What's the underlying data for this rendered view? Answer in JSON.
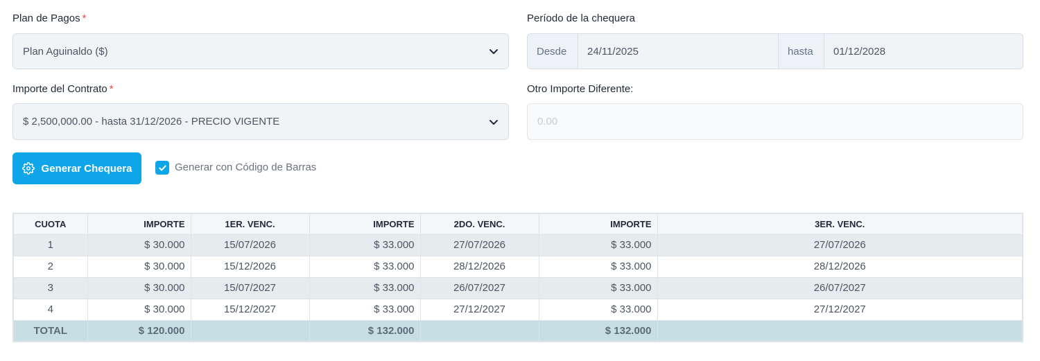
{
  "plan": {
    "label": "Plan de Pagos",
    "required_mark": "*",
    "value": "Plan Aguinaldo ($)"
  },
  "periodo": {
    "label": "Período de la chequera",
    "desde_label": "Desde",
    "desde_value": "24/11/2025",
    "hasta_label": "hasta",
    "hasta_value": "01/12/2028"
  },
  "importe_contrato": {
    "label": "Importe del Contrato",
    "required_mark": "*",
    "value": "$ 2,500,000.00 - hasta 31/12/2026 - PRECIO VIGENTE"
  },
  "otro_importe": {
    "label": "Otro Importe Diferente:",
    "placeholder": "0.00"
  },
  "generar_button": {
    "label": "Generar Chequera",
    "icon": "gear-icon"
  },
  "codigo_barras": {
    "label": "Generar con Código de Barras",
    "checked": true
  },
  "table": {
    "headers": [
      "CUOTA",
      "IMPORTE",
      "1ER. VENC.",
      "IMPORTE",
      "2DO. VENC.",
      "IMPORTE",
      "3ER. VENC."
    ],
    "rows": [
      [
        "1",
        "$ 30.000",
        "15/07/2026",
        "$ 33.000",
        "27/07/2026",
        "$ 33.000",
        "27/07/2026"
      ],
      [
        "2",
        "$ 30.000",
        "15/12/2026",
        "$ 33.000",
        "28/12/2026",
        "$ 33.000",
        "28/12/2026"
      ],
      [
        "3",
        "$ 30.000",
        "15/07/2027",
        "$ 33.000",
        "26/07/2027",
        "$ 33.000",
        "26/07/2027"
      ],
      [
        "4",
        "$ 30.000",
        "15/12/2027",
        "$ 33.000",
        "27/12/2027",
        "$ 33.000",
        "27/12/2027"
      ]
    ],
    "total": [
      "TOTAL",
      "$ 120.000",
      "",
      "$ 132.000",
      "",
      "$ 132.000",
      ""
    ]
  },
  "colors": {
    "accent": "#0ea5e9",
    "required": "#ef4444",
    "total_row": "#c7dfe4",
    "striped_row": "#e6ebee"
  }
}
